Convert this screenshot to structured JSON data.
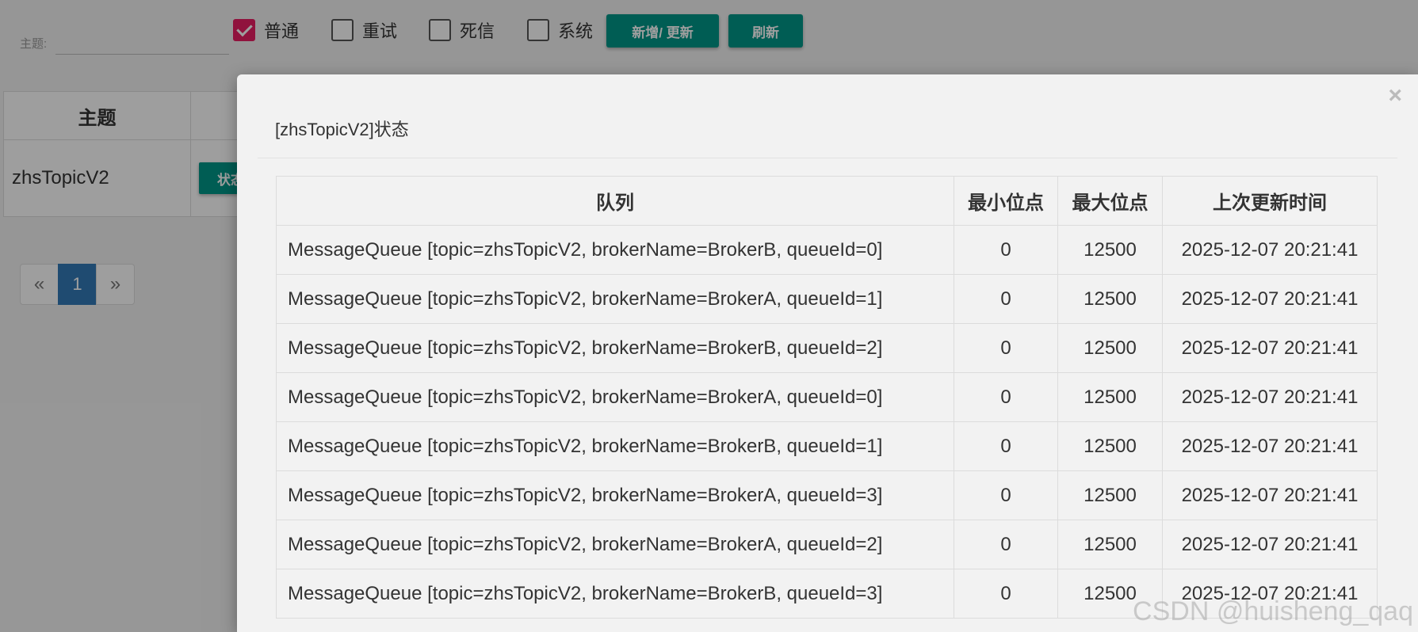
{
  "filter": {
    "topic_label": "主题:",
    "topic_value": "",
    "checkboxes": [
      {
        "label": "普通",
        "checked": true
      },
      {
        "label": "重试",
        "checked": false
      },
      {
        "label": "死信",
        "checked": false
      },
      {
        "label": "系统",
        "checked": false
      }
    ],
    "add_update_label": "新增/ 更新",
    "refresh_label": "刷新"
  },
  "topic_table": {
    "header_topic": "主题",
    "row_topic": "zhsTopicV2",
    "status_button": "状态"
  },
  "pagination": {
    "prev": "«",
    "current": "1",
    "next": "»"
  },
  "modal": {
    "title": "[zhsTopicV2]状态",
    "close": "×",
    "headers": [
      "队列",
      "最小位点",
      "最大位点",
      "上次更新时间"
    ],
    "rows": [
      {
        "queue": "MessageQueue [topic=zhsTopicV2, brokerName=BrokerB, queueId=0]",
        "min": "0",
        "max": "12500",
        "updated": "2025-12-07 20:21:41"
      },
      {
        "queue": "MessageQueue [topic=zhsTopicV2, brokerName=BrokerA, queueId=1]",
        "min": "0",
        "max": "12500",
        "updated": "2025-12-07 20:21:41"
      },
      {
        "queue": "MessageQueue [topic=zhsTopicV2, brokerName=BrokerB, queueId=2]",
        "min": "0",
        "max": "12500",
        "updated": "2025-12-07 20:21:41"
      },
      {
        "queue": "MessageQueue [topic=zhsTopicV2, brokerName=BrokerA, queueId=0]",
        "min": "0",
        "max": "12500",
        "updated": "2025-12-07 20:21:41"
      },
      {
        "queue": "MessageQueue [topic=zhsTopicV2, brokerName=BrokerB, queueId=1]",
        "min": "0",
        "max": "12500",
        "updated": "2025-12-07 20:21:41"
      },
      {
        "queue": "MessageQueue [topic=zhsTopicV2, brokerName=BrokerA, queueId=3]",
        "min": "0",
        "max": "12500",
        "updated": "2025-12-07 20:21:41"
      },
      {
        "queue": "MessageQueue [topic=zhsTopicV2, brokerName=BrokerA, queueId=2]",
        "min": "0",
        "max": "12500",
        "updated": "2025-12-07 20:21:41"
      },
      {
        "queue": "MessageQueue [topic=zhsTopicV2, brokerName=BrokerB, queueId=3]",
        "min": "0",
        "max": "12500",
        "updated": "2025-12-07 20:21:41"
      }
    ]
  },
  "watermark": "CSDN @huisheng_qaq",
  "colors": {
    "accent": "#009688",
    "checkbox_checked": "#e91e63",
    "pager_active": "#337ab7"
  }
}
